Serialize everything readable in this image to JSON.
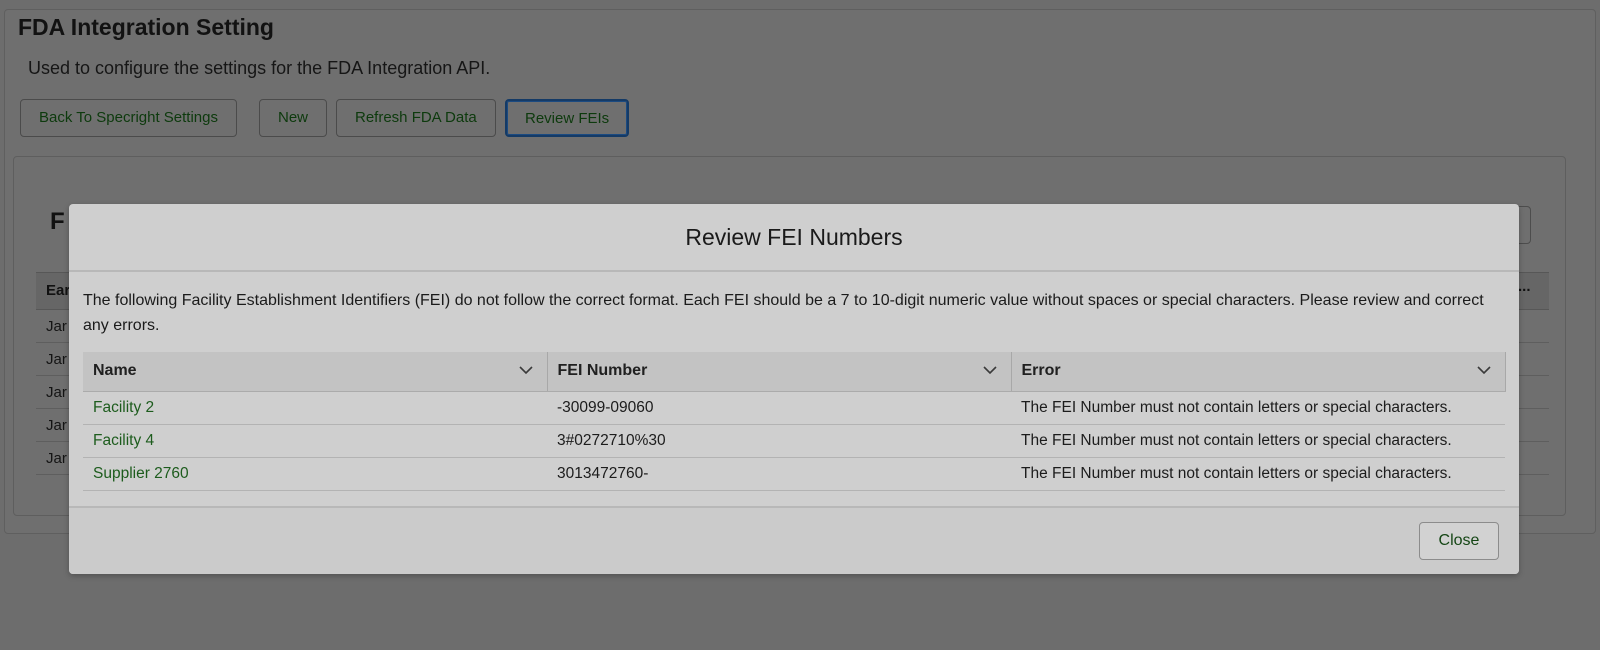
{
  "page": {
    "title": "FDA Integration Setting",
    "description": "Used to configure the settings for the FDA Integration API.",
    "buttons": {
      "back": "Back To Specright Settings",
      "new": "New",
      "refresh": "Refresh FDA Data",
      "review": "Review FEIs"
    },
    "card": {
      "heading_partial": "F",
      "column_partial": "Ear",
      "more_label": "...",
      "row_partials": [
        "Jar",
        "Jar",
        "Jar",
        "Jar",
        "Jar"
      ]
    }
  },
  "modal": {
    "title": "Review FEI Numbers",
    "description": "The following Facility Establishment Identifiers (FEI) do not follow the correct format. Each FEI should be a 7 to 10-digit numeric value without spaces or special characters. Please review and correct any errors.",
    "columns": [
      "Name",
      "FEI Number",
      "Error"
    ],
    "rows": [
      {
        "name": "Facility 2",
        "fei": "-30099-09060",
        "error": "The FEI Number must not contain letters or special characters."
      },
      {
        "name": "Facility 4",
        "fei": "3#0272710%30",
        "error": "The FEI Number must not contain letters or special characters."
      },
      {
        "name": "Supplier 2760",
        "fei": "3013472760-",
        "error": "The FEI Number must not contain letters or special characters."
      }
    ],
    "close_label": "Close"
  },
  "colors": {
    "overlay": "#6d6d6d",
    "modal_bg": "#cfcfcf",
    "link_green": "#1d5c1d",
    "focus_blue": "#143a66"
  }
}
